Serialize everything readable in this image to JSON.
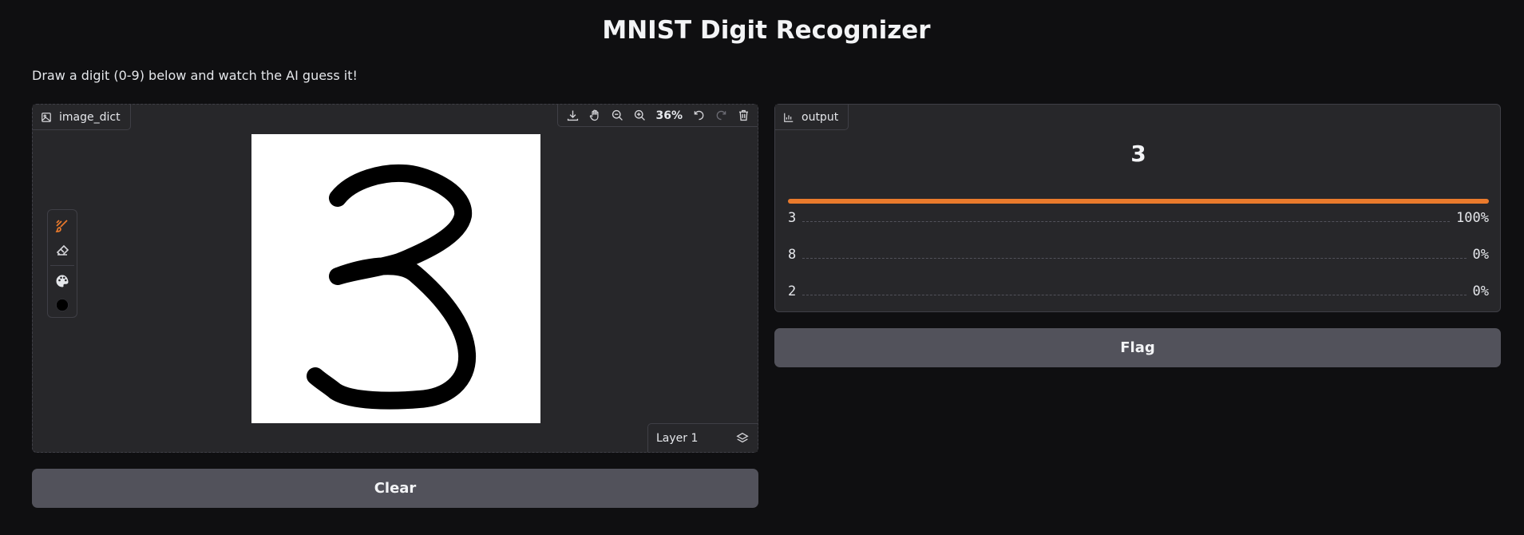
{
  "page": {
    "title": "MNIST Digit Recognizer",
    "description": "Draw a digit (0-9) below and watch the AI guess it!"
  },
  "input_panel": {
    "label": "image_dict",
    "zoom": "36%",
    "layer_label": "Layer 1",
    "toolbar_icons": [
      "download-icon",
      "pan-icon",
      "zoom-out-icon",
      "zoom-in-icon",
      "undo-icon",
      "redo-icon",
      "trash-icon"
    ],
    "tool_icons": [
      "brush-icon",
      "eraser-icon",
      "palette-icon",
      "brush-size-icon"
    ]
  },
  "output_panel": {
    "label": "output",
    "top_prediction": "3",
    "top_confidence": 1.0,
    "confidences": [
      {
        "label": "3",
        "value": "100%"
      },
      {
        "label": "8",
        "value": "0%"
      },
      {
        "label": "2",
        "value": "0%"
      }
    ]
  },
  "buttons": {
    "clear": "Clear",
    "flag": "Flag"
  },
  "colors": {
    "background": "#0f0f11",
    "panel": "#27272a",
    "accent": "#ea7a2c",
    "button": "#52525b"
  }
}
